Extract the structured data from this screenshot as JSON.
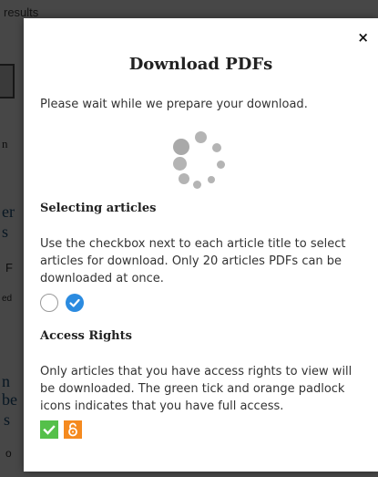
{
  "background": {
    "results_text": "results",
    "fragments": [
      "n",
      "er",
      "s",
      "F",
      "ed",
      "n",
      "be",
      "s",
      "o"
    ]
  },
  "modal": {
    "close_label": "×",
    "title": "Download PDFs",
    "wait_message": "Please wait while we prepare your download.",
    "spinner": "loading-spinner",
    "selecting": {
      "heading": "Selecting articles",
      "body": "Use the checkbox next to each article title to select articles for download. Only 20 articles PDFs can be downloaded at once."
    },
    "access": {
      "heading": "Access Rights",
      "body": "Only articles that you have access rights to view will be downloaded. The green tick and orange padlock icons indicates that you have full access."
    }
  },
  "colors": {
    "overlay": "#000000b8",
    "checkbox_checked": "#2b8be0",
    "tick_green": "#55c04a",
    "padlock_orange": "#f58a1f",
    "spinner_gray": "#b4b4b4"
  },
  "icons": {
    "close": "close-icon",
    "unchecked": "unchecked-circle-icon",
    "checked": "checked-circle-icon",
    "tick": "green-tick-icon",
    "padlock": "open-padlock-icon"
  }
}
